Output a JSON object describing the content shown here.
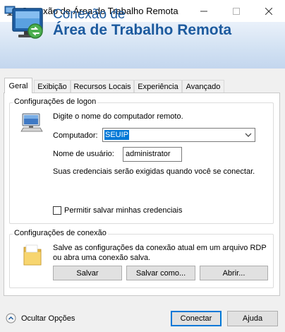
{
  "window": {
    "title": "Conexão de Área de Trabalho Remota",
    "minimize_icon": "minimize-icon",
    "maximize_icon": "maximize-icon",
    "close_icon": "close-icon"
  },
  "banner": {
    "line1": "Conexão de",
    "line2": "Área de Trabalho Remota",
    "title_color": "#1c5a9e"
  },
  "tabs": [
    {
      "label": "Geral",
      "active": true
    },
    {
      "label": "Exibição",
      "active": false
    },
    {
      "label": "Recursos Locais",
      "active": false
    },
    {
      "label": "Experiência",
      "active": false
    },
    {
      "label": "Avançado",
      "active": false
    }
  ],
  "logon": {
    "legend": "Configurações de logon",
    "instruction": "Digite o nome do computador remoto.",
    "computer_label": "Computador:",
    "computer_value": "SEUIP",
    "username_label": "Nome de usuário:",
    "username_value": "administrator",
    "credentials_note": "Suas credenciais serão exigidas quando você se conectar.",
    "save_credentials_label": "Permitir salvar minhas credenciais",
    "save_credentials_checked": false
  },
  "connection": {
    "legend": "Configurações de conexão",
    "description_line1": "Salve as configurações da conexão atual em um arquivo RDP",
    "description_line2": "ou abra uma conexão salva.",
    "save_label": "Salvar",
    "save_as_label": "Salvar como...",
    "open_label": "Abrir..."
  },
  "footer": {
    "hide_options_label": "Ocultar Opções",
    "connect_label": "Conectar",
    "help_label": "Ajuda"
  },
  "colors": {
    "selection": "#0078d7",
    "accent": "#1c5a9e"
  }
}
